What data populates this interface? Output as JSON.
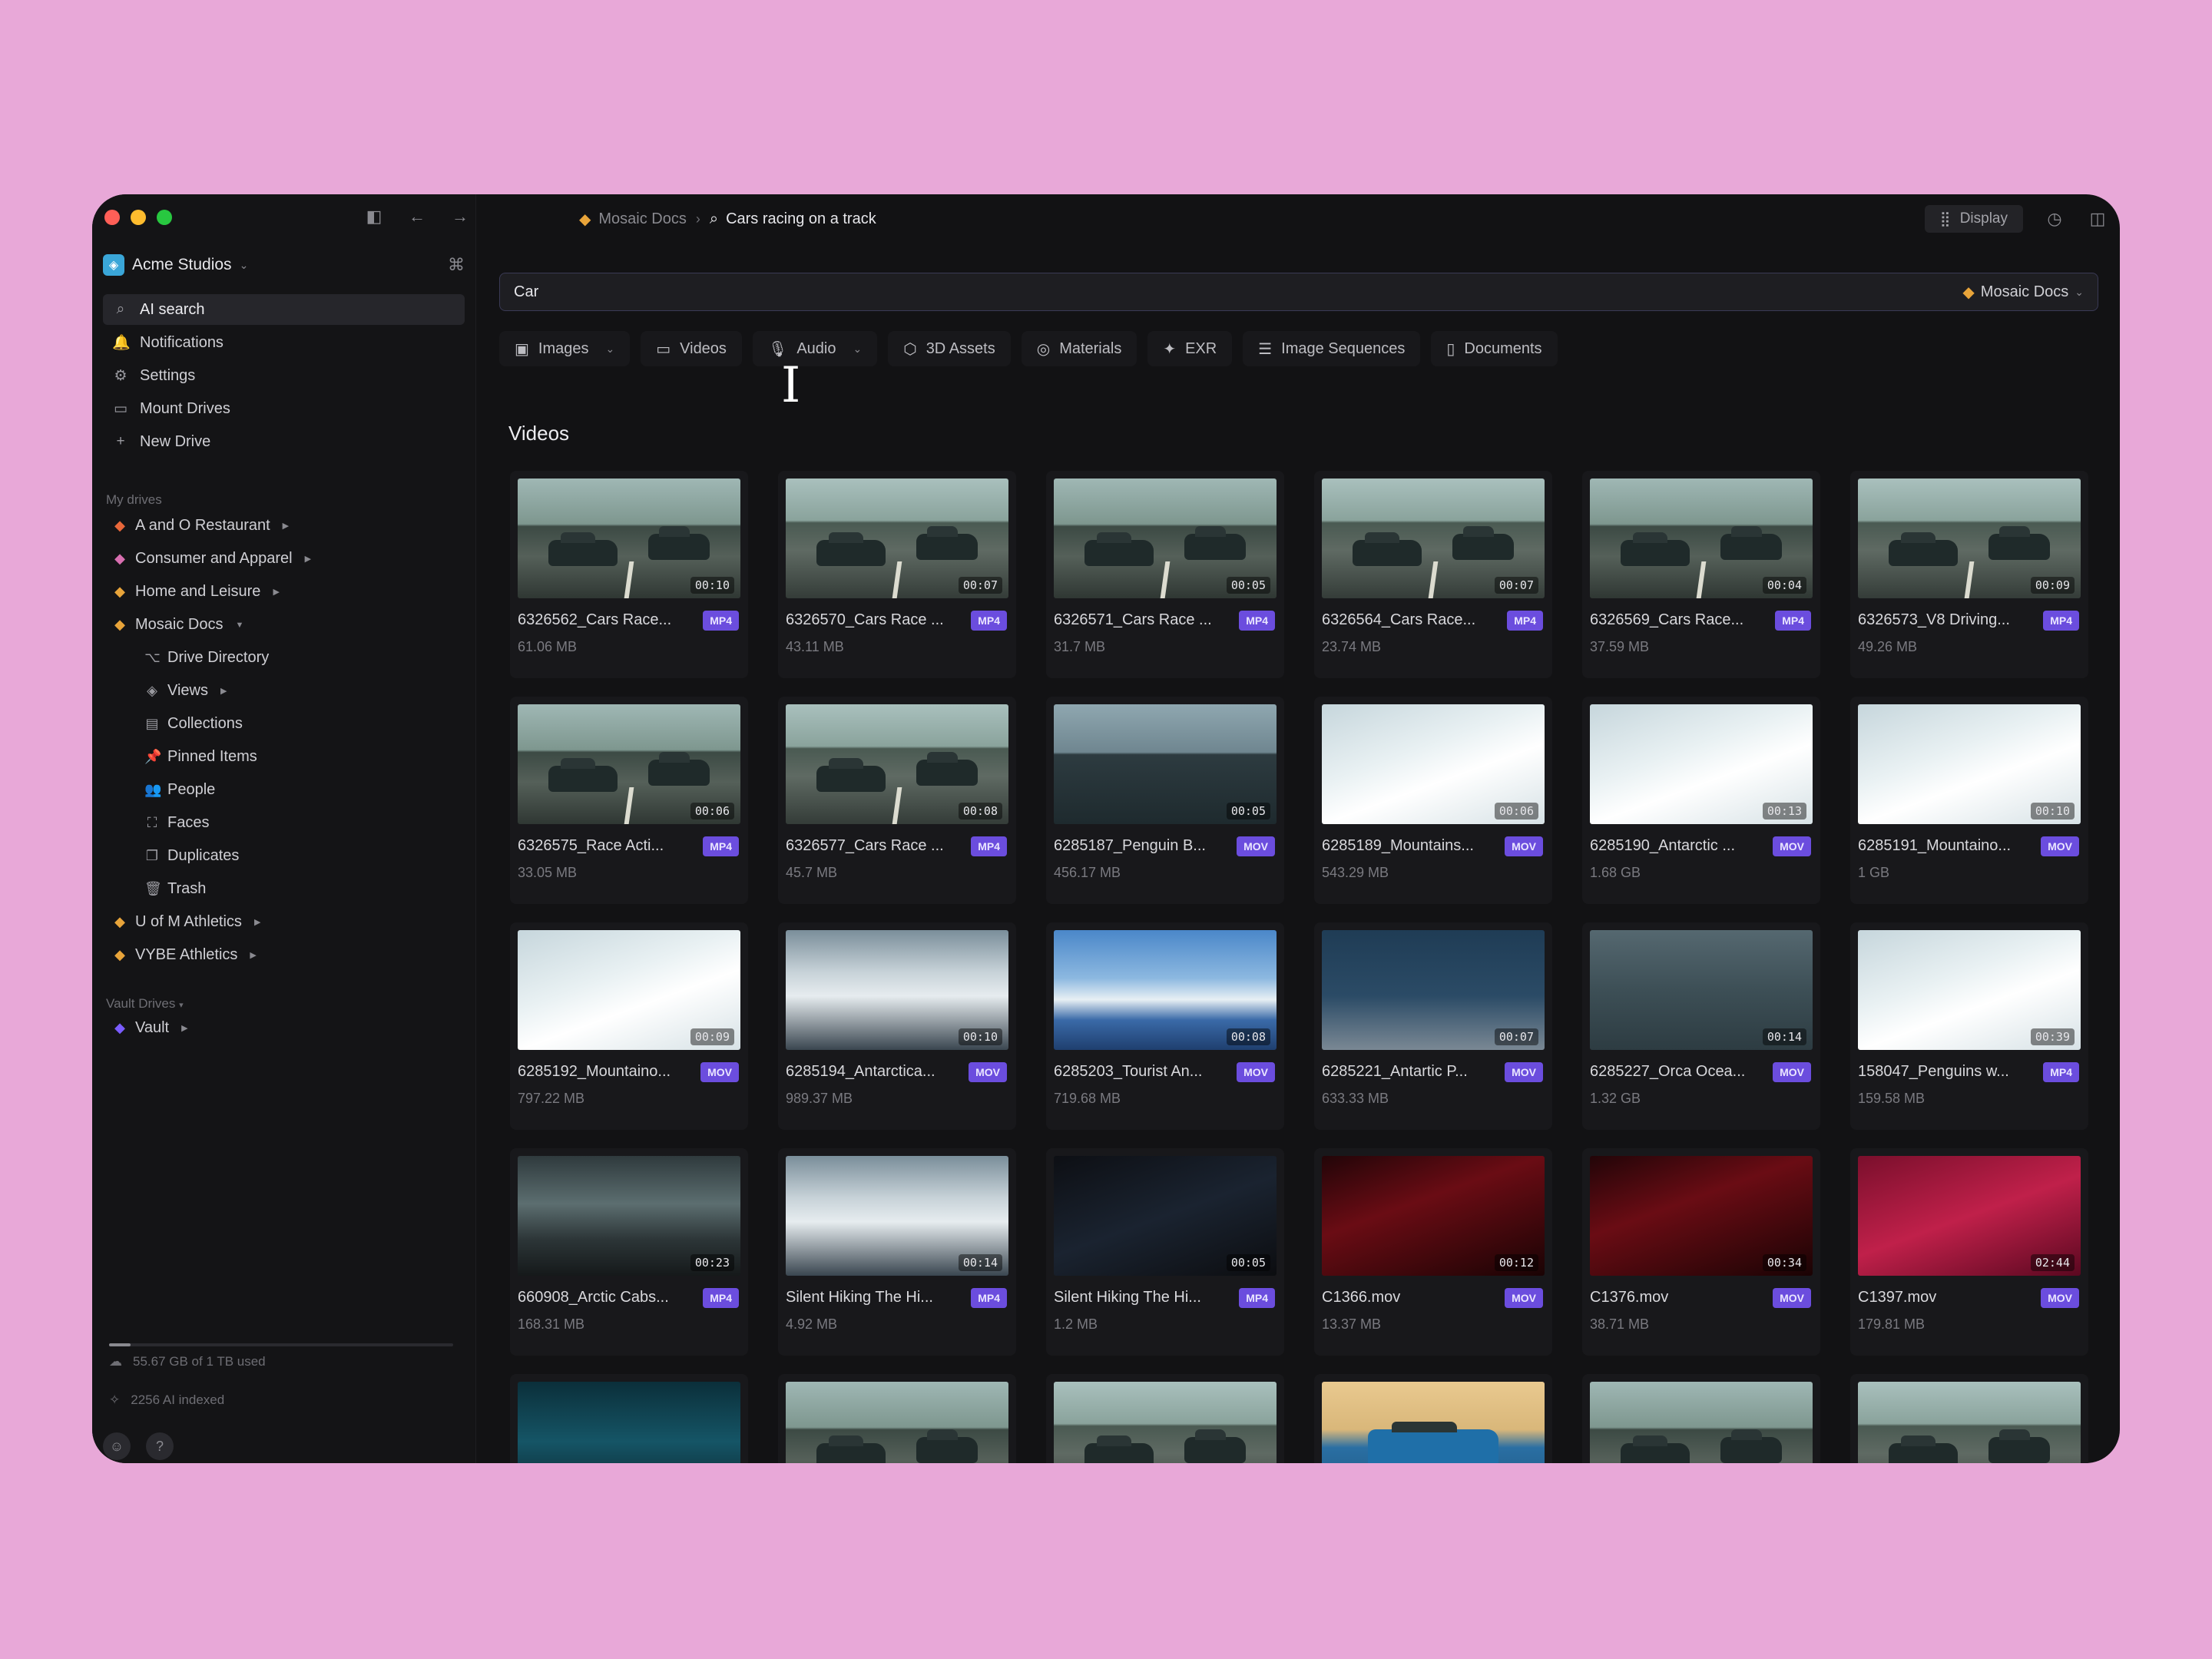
{
  "window": {
    "traffic_colors": [
      "#ff5f57",
      "#febc2e",
      "#28c840"
    ]
  },
  "sidebar": {
    "workspace": "Acme Studios",
    "nav": [
      {
        "label": "AI search",
        "icon": "search-icon"
      },
      {
        "label": "Notifications",
        "icon": "bell-icon"
      },
      {
        "label": "Settings",
        "icon": "gear-icon"
      },
      {
        "label": "Mount Drives",
        "icon": "drive-icon"
      },
      {
        "label": "New Drive",
        "icon": "plus-icon"
      }
    ],
    "my_drives_label": "My drives",
    "drives": [
      {
        "label": "A and O Restaurant",
        "icon": "drive-icon",
        "color": "#e8673a"
      },
      {
        "label": "Consumer and Apparel",
        "icon": "drive-icon",
        "color": "#d86fb0"
      },
      {
        "label": "Home and Leisure",
        "icon": "drive-icon",
        "color": "#e8a43a"
      },
      {
        "label": "Mosaic Docs",
        "icon": "drive-icon",
        "color": "#e8a43a"
      }
    ],
    "mosaic_children": [
      {
        "label": "Drive Directory",
        "icon": "directory-icon"
      },
      {
        "label": "Views",
        "icon": "layers-icon"
      },
      {
        "label": "Collections",
        "icon": "collections-icon"
      },
      {
        "label": "Pinned Items",
        "icon": "pin-icon"
      },
      {
        "label": "People",
        "icon": "people-icon"
      },
      {
        "label": "Faces",
        "icon": "face-icon"
      },
      {
        "label": "Duplicates",
        "icon": "duplicates-icon"
      },
      {
        "label": "Trash",
        "icon": "trash-icon"
      }
    ],
    "more_drives": [
      {
        "label": "U of M Athletics",
        "icon": "drive-icon",
        "color": "#e8a43a"
      },
      {
        "label": "VYBE Athletics",
        "icon": "drive-icon",
        "color": "#e8a43a"
      }
    ],
    "vault_label": "Vault Drives",
    "vault": [
      {
        "label": "Vault",
        "icon": "vault-icon",
        "color": "#7a5cff"
      }
    ],
    "storage_text": "55.67 GB of 1 TB used",
    "indexed_text": "2256 AI indexed"
  },
  "topbar": {
    "crumb_drive": "Mosaic Docs",
    "crumb_query": "Cars racing on a track",
    "display_label": "Display"
  },
  "search": {
    "value": "Car",
    "scope": "Mosaic Docs"
  },
  "filters": [
    {
      "label": "Images",
      "icon": "image-icon",
      "dropdown": true
    },
    {
      "label": "Videos",
      "icon": "video-icon",
      "dropdown": false
    },
    {
      "label": "Audio",
      "icon": "mic-icon",
      "dropdown": true
    },
    {
      "label": "3D Assets",
      "icon": "cube-icon",
      "dropdown": false
    },
    {
      "label": "Materials",
      "icon": "material-icon",
      "dropdown": false
    },
    {
      "label": "EXR",
      "icon": "exr-icon",
      "dropdown": false
    },
    {
      "label": "Image Sequences",
      "icon": "sequence-icon",
      "dropdown": false
    },
    {
      "label": "Documents",
      "icon": "document-icon",
      "dropdown": false
    }
  ],
  "section_title": "Videos",
  "videos": [
    {
      "name": "6326562_Cars Race...",
      "size": "61.06 MB",
      "type": "MP4",
      "duration": "00:10",
      "theme": "t-road"
    },
    {
      "name": "6326570_Cars Race ...",
      "size": "43.11 MB",
      "type": "MP4",
      "duration": "00:07",
      "theme": "t-road2"
    },
    {
      "name": "6326571_Cars Race ...",
      "size": "31.7 MB",
      "type": "MP4",
      "duration": "00:05",
      "theme": "t-road"
    },
    {
      "name": "6326564_Cars Race...",
      "size": "23.74 MB",
      "type": "MP4",
      "duration": "00:07",
      "theme": "t-road2"
    },
    {
      "name": "6326569_Cars Race...",
      "size": "37.59 MB",
      "type": "MP4",
      "duration": "00:04",
      "theme": "t-road"
    },
    {
      "name": "6326573_V8 Driving...",
      "size": "49.26 MB",
      "type": "MP4",
      "duration": "00:09",
      "theme": "t-road2"
    },
    {
      "name": "6326575_Race Acti...",
      "size": "33.05 MB",
      "type": "MP4",
      "duration": "00:06",
      "theme": "t-road"
    },
    {
      "name": "6326577_Cars Race ...",
      "size": "45.7 MB",
      "type": "MP4",
      "duration": "00:08",
      "theme": "t-road2"
    },
    {
      "name": "6285187_Penguin B...",
      "size": "456.17 MB",
      "type": "MOV",
      "duration": "00:05",
      "theme": "t-sea"
    },
    {
      "name": "6285189_Mountains...",
      "size": "543.29 MB",
      "type": "MOV",
      "duration": "00:06",
      "theme": "t-snow"
    },
    {
      "name": "6285190_Antarctic ...",
      "size": "1.68 GB",
      "type": "MOV",
      "duration": "00:13",
      "theme": "t-snow"
    },
    {
      "name": "6285191_Mountaino...",
      "size": "1 GB",
      "type": "MOV",
      "duration": "00:10",
      "theme": "t-snow"
    },
    {
      "name": "6285192_Mountaino...",
      "size": "797.22 MB",
      "type": "MOV",
      "duration": "00:09",
      "theme": "t-snow"
    },
    {
      "name": "6285194_Antarctica...",
      "size": "989.37 MB",
      "type": "MOV",
      "duration": "00:10",
      "theme": "t-mount"
    },
    {
      "name": "6285203_Tourist An...",
      "size": "719.68 MB",
      "type": "MOV",
      "duration": "00:08",
      "theme": "t-tourist"
    },
    {
      "name": "6285221_Antartic P...",
      "size": "633.33 MB",
      "type": "MOV",
      "duration": "00:07",
      "theme": "t-penguin"
    },
    {
      "name": "6285227_Orca Ocea...",
      "size": "1.32 GB",
      "type": "MOV",
      "duration": "00:14",
      "theme": "t-ocean"
    },
    {
      "name": "158047_Penguins w...",
      "size": "159.58 MB",
      "type": "MP4",
      "duration": "00:39",
      "theme": "t-snow"
    },
    {
      "name": "660908_Arctic Cabs...",
      "size": "168.31 MB",
      "type": "MP4",
      "duration": "00:23",
      "theme": "t-arctic"
    },
    {
      "name": "Silent Hiking The Hi...",
      "size": "4.92 MB",
      "type": "MP4",
      "duration": "00:14",
      "theme": "t-mount"
    },
    {
      "name": "Silent Hiking The Hi...",
      "size": "1.2 MB",
      "type": "MP4",
      "duration": "00:05",
      "theme": "t-dark"
    },
    {
      "name": "C1366.mov",
      "size": "13.37 MB",
      "type": "MOV",
      "duration": "00:12",
      "theme": "t-red"
    },
    {
      "name": "C1376.mov",
      "size": "38.71 MB",
      "type": "MOV",
      "duration": "00:34",
      "theme": "t-red"
    },
    {
      "name": "C1397.mov",
      "size": "179.81 MB",
      "type": "MOV",
      "duration": "02:44",
      "theme": "t-pink"
    }
  ],
  "partial_row": [
    "t-cave",
    "t-road",
    "t-road2",
    "t-blue-car",
    "t-road",
    "t-road2"
  ]
}
